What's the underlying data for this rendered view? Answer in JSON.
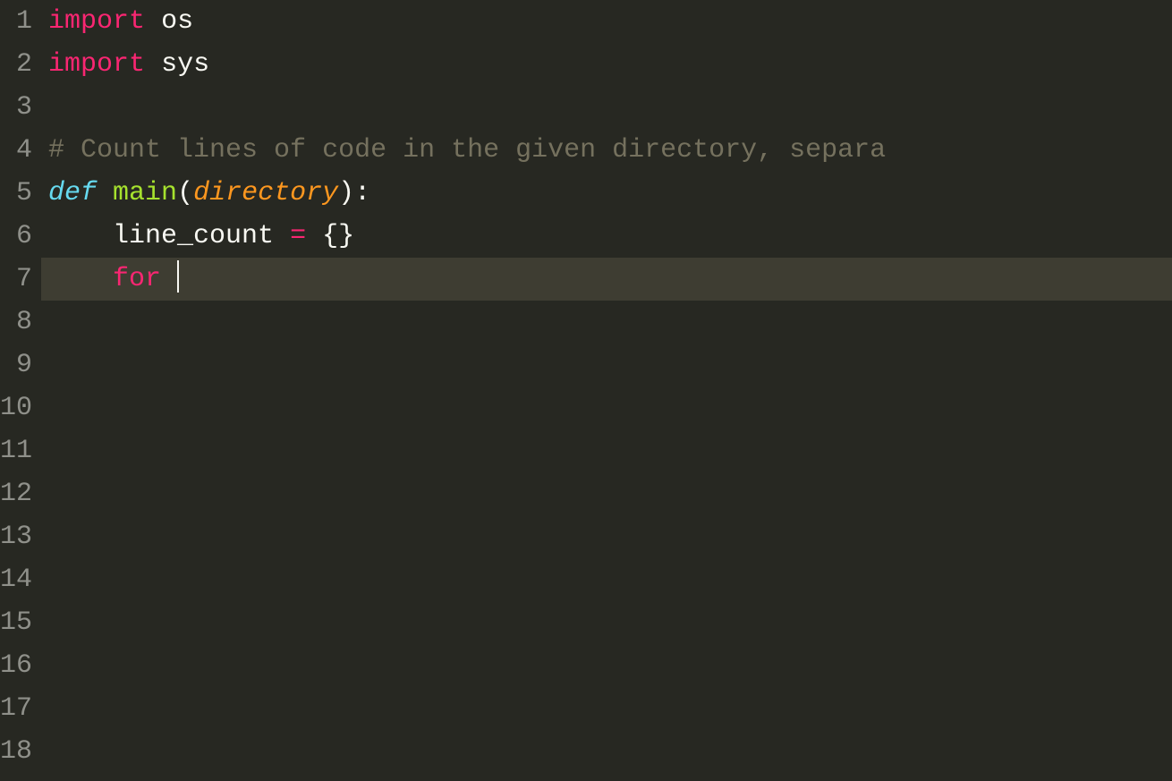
{
  "editor": {
    "total_lines": 18,
    "active_line": 7,
    "lines": {
      "1": {
        "tokens": [
          {
            "cls": "kw-import",
            "text": "import"
          },
          {
            "cls": "",
            "text": " "
          },
          {
            "cls": "module",
            "text": "os"
          }
        ]
      },
      "2": {
        "tokens": [
          {
            "cls": "kw-import",
            "text": "import"
          },
          {
            "cls": "",
            "text": " "
          },
          {
            "cls": "module",
            "text": "sys"
          }
        ]
      },
      "3": {
        "tokens": []
      },
      "4": {
        "tokens": [
          {
            "cls": "comment",
            "text": "# Count lines of code in the given directory, separa"
          }
        ]
      },
      "5": {
        "tokens": [
          {
            "cls": "kw-def",
            "text": "def"
          },
          {
            "cls": "",
            "text": " "
          },
          {
            "cls": "func-name",
            "text": "main"
          },
          {
            "cls": "punct",
            "text": "("
          },
          {
            "cls": "param",
            "text": "directory"
          },
          {
            "cls": "punct",
            "text": "):"
          }
        ]
      },
      "6": {
        "tokens": [
          {
            "cls": "",
            "text": "    "
          },
          {
            "cls": "ident",
            "text": "line_count"
          },
          {
            "cls": "",
            "text": " "
          },
          {
            "cls": "operator",
            "text": "="
          },
          {
            "cls": "",
            "text": " "
          },
          {
            "cls": "punct",
            "text": "{}"
          }
        ]
      },
      "7": {
        "tokens": [
          {
            "cls": "",
            "text": "    "
          },
          {
            "cls": "kw-for",
            "text": "for"
          },
          {
            "cls": "",
            "text": " "
          }
        ],
        "cursor": true
      },
      "8": {
        "tokens": []
      },
      "9": {
        "tokens": []
      },
      "10": {
        "tokens": []
      },
      "11": {
        "tokens": []
      },
      "12": {
        "tokens": []
      },
      "13": {
        "tokens": []
      },
      "14": {
        "tokens": []
      },
      "15": {
        "tokens": []
      },
      "16": {
        "tokens": []
      },
      "17": {
        "tokens": []
      },
      "18": {
        "tokens": []
      }
    }
  }
}
